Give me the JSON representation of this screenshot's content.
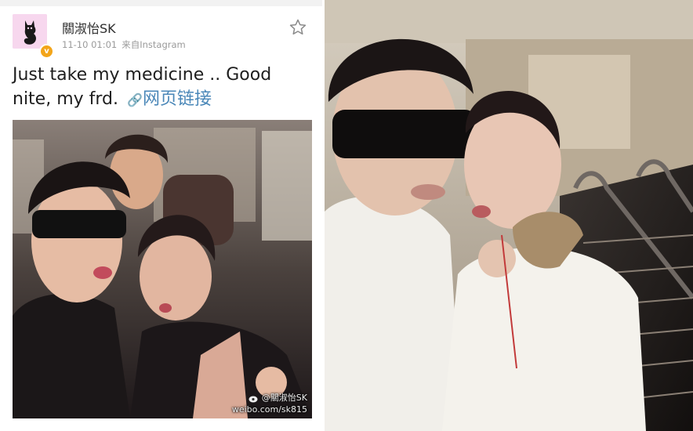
{
  "post": {
    "username": "關淑怡SK",
    "timestamp": "11-10 01:01",
    "source": "来自Instagram",
    "verified_badge": "v",
    "text": "Just take my medicine .. Good nite, my frd.",
    "link_label": "网页链接",
    "link_icon": "link-icon",
    "favorite_icon": "star-outline-icon"
  },
  "photo_left": {
    "watermark_handle": "@關淑怡SK",
    "watermark_url": "weibo.com/sk815"
  },
  "colors": {
    "link": "#4a87b8",
    "badge": "#f3a51a",
    "meta_text": "#9a9a9a"
  }
}
